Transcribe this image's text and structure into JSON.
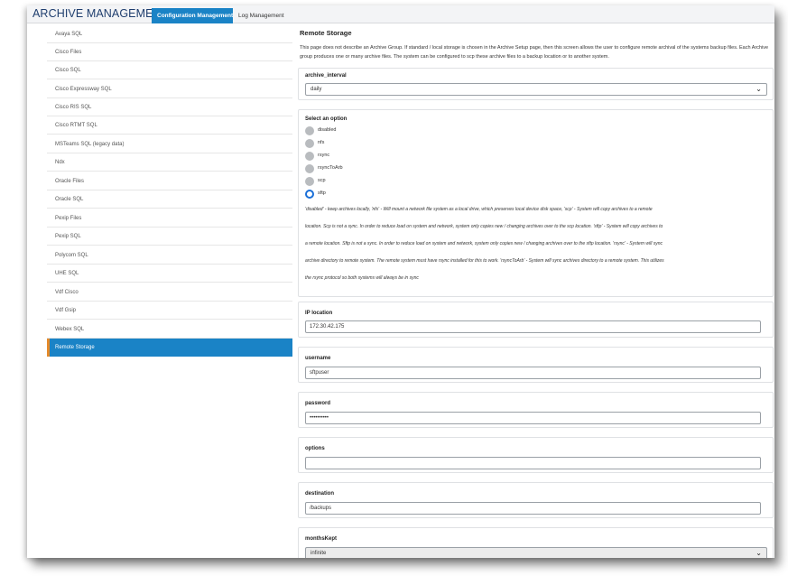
{
  "app": {
    "title": "ARCHIVE MANAGEMENT"
  },
  "tabs": [
    {
      "label": "Configuration Management",
      "active": true
    },
    {
      "label": "Log Management",
      "active": false
    }
  ],
  "sidebar": {
    "items": [
      {
        "label": "Avaya SQL"
      },
      {
        "label": "Cisco Files"
      },
      {
        "label": "Cisco SQL"
      },
      {
        "label": "Cisco Expressway SQL"
      },
      {
        "label": "Cisco RIS SQL"
      },
      {
        "label": "Cisco RTMT SQL"
      },
      {
        "label": "MSTeams SQL (legacy data)"
      },
      {
        "label": "Ndx"
      },
      {
        "label": "Oracle Files"
      },
      {
        "label": "Oracle SQL"
      },
      {
        "label": "Pexip Files"
      },
      {
        "label": "Pexip SQL"
      },
      {
        "label": "Polycom SQL"
      },
      {
        "label": "UHE SQL"
      },
      {
        "label": "Vdf Cisco"
      },
      {
        "label": "Vdf Gsip"
      },
      {
        "label": "Webex SQL"
      },
      {
        "label": "Remote Storage",
        "active": true
      }
    ]
  },
  "main": {
    "title": "Remote Storage",
    "description": "This page does not describe an Archive Group. If standard / local storage is chosen in the Archive Setup page, then this screen allows the user to configure remote archival of the systems backup files. Each Archive group produces one or many archive files. The system can be configured to scp these archive files to a backup location or to another system.",
    "archive_interval": {
      "label": "archive_interval",
      "value": "daily"
    },
    "option": {
      "label": "Select an option",
      "choices": [
        "disabled",
        "nfs",
        "rsync",
        "rsyncToArb",
        "scp",
        "sftp"
      ],
      "selected": "sftp",
      "help": [
        "'disabled' - keep archives locally, 'nfs' - Will mount a network file system as a local drive, which preserves local device disk space, 'scp' - System will copy archives to a remote",
        "location. Scp is not a sync. In order to reduce load on system and network, system only copies new / changing archives over to the scp location. 'sftp' - System will copy archives to",
        "a remote location. Sftp is not a sync. In order to reduce load on system and network, system only copies new / changing archives over to the sftp location. 'rsync' - System will sync",
        "archive directory to remote system. The remote system must have rsync installed for this to work. 'rsyncToArb' - System will sync archives directory to a remote system. This utilizes",
        "the rsync protocol so both systems will always be in sync"
      ]
    },
    "ip_location": {
      "label": "IP location",
      "value": "172.30.42.175"
    },
    "username": {
      "label": "username",
      "value": "sftpuser"
    },
    "password": {
      "label": "password",
      "value": "••••••••••"
    },
    "options": {
      "label": "options",
      "value": ""
    },
    "destination": {
      "label": "destination",
      "value": "/backups"
    },
    "months_kept": {
      "label": "monthsKept",
      "value": "infinite"
    }
  }
}
